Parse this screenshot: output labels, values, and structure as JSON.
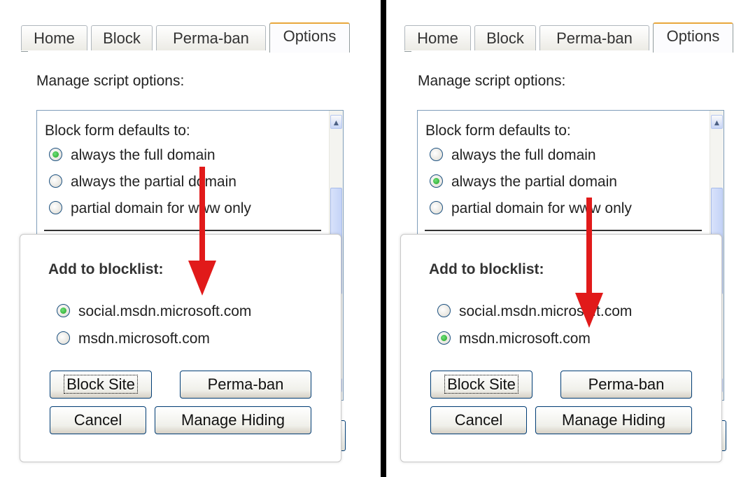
{
  "panels": [
    {
      "tabs": [
        "Home",
        "Block",
        "Perma-ban",
        "Options"
      ],
      "active_tab": "Options",
      "manage_label": "Manage script options:",
      "block_form": {
        "heading": "Block form defaults to:",
        "options": [
          {
            "label": "always the full domain",
            "checked": true
          },
          {
            "label": "always the partial domain",
            "checked": false
          },
          {
            "label": "partial domain for www only",
            "checked": false
          }
        ]
      },
      "popup": {
        "title": "Add to blocklist:",
        "options": [
          {
            "label": "social.msdn.microsoft.com",
            "checked": true
          },
          {
            "label": "msdn.microsoft.com",
            "checked": false
          }
        ],
        "buttons": {
          "block_site": "Block Site",
          "perma_ban": "Perma-ban",
          "cancel": "Cancel",
          "manage_hiding": "Manage Hiding"
        }
      }
    },
    {
      "tabs": [
        "Home",
        "Block",
        "Perma-ban",
        "Options"
      ],
      "active_tab": "Options",
      "manage_label": "Manage script options:",
      "block_form": {
        "heading": "Block form defaults to:",
        "options": [
          {
            "label": "always the full domain",
            "checked": false
          },
          {
            "label": "always the partial domain",
            "checked": true
          },
          {
            "label": "partial domain for www only",
            "checked": false
          }
        ]
      },
      "popup": {
        "title": "Add to blocklist:",
        "options": [
          {
            "label": "social.msdn.microsoft.com",
            "checked": false
          },
          {
            "label": "msdn.microsoft.com",
            "checked": true
          }
        ],
        "buttons": {
          "block_site": "Block Site",
          "perma_ban": "Perma-ban",
          "cancel": "Cancel",
          "manage_hiding": "Manage Hiding"
        }
      }
    }
  ],
  "colors": {
    "arrow": "#e11a1a",
    "active_tab_accent": "#e8a73c",
    "radio_checked": "#21a121",
    "button_border": "#003c74"
  },
  "icons": [
    "scroll-up-arrow-icon",
    "scroll-down-arrow-icon",
    "red-arrow-annotation"
  ]
}
